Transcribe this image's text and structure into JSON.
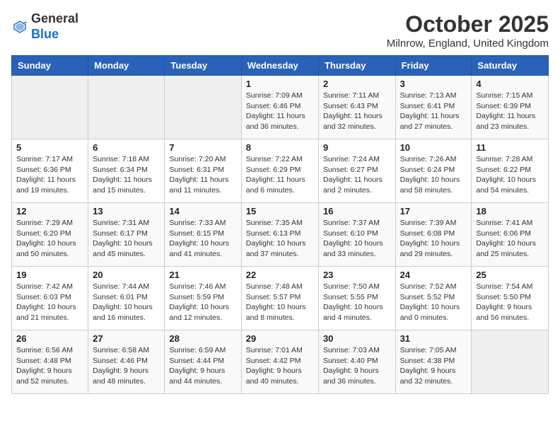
{
  "logo": {
    "general": "General",
    "blue": "Blue"
  },
  "title": "October 2025",
  "location": "Milnrow, England, United Kingdom",
  "days_of_week": [
    "Sunday",
    "Monday",
    "Tuesday",
    "Wednesday",
    "Thursday",
    "Friday",
    "Saturday"
  ],
  "weeks": [
    [
      {
        "num": "",
        "info": ""
      },
      {
        "num": "",
        "info": ""
      },
      {
        "num": "",
        "info": ""
      },
      {
        "num": "1",
        "info": "Sunrise: 7:09 AM\nSunset: 6:46 PM\nDaylight: 11 hours and 36 minutes."
      },
      {
        "num": "2",
        "info": "Sunrise: 7:11 AM\nSunset: 6:43 PM\nDaylight: 11 hours and 32 minutes."
      },
      {
        "num": "3",
        "info": "Sunrise: 7:13 AM\nSunset: 6:41 PM\nDaylight: 11 hours and 27 minutes."
      },
      {
        "num": "4",
        "info": "Sunrise: 7:15 AM\nSunset: 6:39 PM\nDaylight: 11 hours and 23 minutes."
      }
    ],
    [
      {
        "num": "5",
        "info": "Sunrise: 7:17 AM\nSunset: 6:36 PM\nDaylight: 11 hours and 19 minutes."
      },
      {
        "num": "6",
        "info": "Sunrise: 7:18 AM\nSunset: 6:34 PM\nDaylight: 11 hours and 15 minutes."
      },
      {
        "num": "7",
        "info": "Sunrise: 7:20 AM\nSunset: 6:31 PM\nDaylight: 11 hours and 11 minutes."
      },
      {
        "num": "8",
        "info": "Sunrise: 7:22 AM\nSunset: 6:29 PM\nDaylight: 11 hours and 6 minutes."
      },
      {
        "num": "9",
        "info": "Sunrise: 7:24 AM\nSunset: 6:27 PM\nDaylight: 11 hours and 2 minutes."
      },
      {
        "num": "10",
        "info": "Sunrise: 7:26 AM\nSunset: 6:24 PM\nDaylight: 10 hours and 58 minutes."
      },
      {
        "num": "11",
        "info": "Sunrise: 7:28 AM\nSunset: 6:22 PM\nDaylight: 10 hours and 54 minutes."
      }
    ],
    [
      {
        "num": "12",
        "info": "Sunrise: 7:29 AM\nSunset: 6:20 PM\nDaylight: 10 hours and 50 minutes."
      },
      {
        "num": "13",
        "info": "Sunrise: 7:31 AM\nSunset: 6:17 PM\nDaylight: 10 hours and 45 minutes."
      },
      {
        "num": "14",
        "info": "Sunrise: 7:33 AM\nSunset: 6:15 PM\nDaylight: 10 hours and 41 minutes."
      },
      {
        "num": "15",
        "info": "Sunrise: 7:35 AM\nSunset: 6:13 PM\nDaylight: 10 hours and 37 minutes."
      },
      {
        "num": "16",
        "info": "Sunrise: 7:37 AM\nSunset: 6:10 PM\nDaylight: 10 hours and 33 minutes."
      },
      {
        "num": "17",
        "info": "Sunrise: 7:39 AM\nSunset: 6:08 PM\nDaylight: 10 hours and 29 minutes."
      },
      {
        "num": "18",
        "info": "Sunrise: 7:41 AM\nSunset: 6:06 PM\nDaylight: 10 hours and 25 minutes."
      }
    ],
    [
      {
        "num": "19",
        "info": "Sunrise: 7:42 AM\nSunset: 6:03 PM\nDaylight: 10 hours and 21 minutes."
      },
      {
        "num": "20",
        "info": "Sunrise: 7:44 AM\nSunset: 6:01 PM\nDaylight: 10 hours and 16 minutes."
      },
      {
        "num": "21",
        "info": "Sunrise: 7:46 AM\nSunset: 5:59 PM\nDaylight: 10 hours and 12 minutes."
      },
      {
        "num": "22",
        "info": "Sunrise: 7:48 AM\nSunset: 5:57 PM\nDaylight: 10 hours and 8 minutes."
      },
      {
        "num": "23",
        "info": "Sunrise: 7:50 AM\nSunset: 5:55 PM\nDaylight: 10 hours and 4 minutes."
      },
      {
        "num": "24",
        "info": "Sunrise: 7:52 AM\nSunset: 5:52 PM\nDaylight: 10 hours and 0 minutes."
      },
      {
        "num": "25",
        "info": "Sunrise: 7:54 AM\nSunset: 5:50 PM\nDaylight: 9 hours and 56 minutes."
      }
    ],
    [
      {
        "num": "26",
        "info": "Sunrise: 6:56 AM\nSunset: 4:48 PM\nDaylight: 9 hours and 52 minutes."
      },
      {
        "num": "27",
        "info": "Sunrise: 6:58 AM\nSunset: 4:46 PM\nDaylight: 9 hours and 48 minutes."
      },
      {
        "num": "28",
        "info": "Sunrise: 6:59 AM\nSunset: 4:44 PM\nDaylight: 9 hours and 44 minutes."
      },
      {
        "num": "29",
        "info": "Sunrise: 7:01 AM\nSunset: 4:42 PM\nDaylight: 9 hours and 40 minutes."
      },
      {
        "num": "30",
        "info": "Sunrise: 7:03 AM\nSunset: 4:40 PM\nDaylight: 9 hours and 36 minutes."
      },
      {
        "num": "31",
        "info": "Sunrise: 7:05 AM\nSunset: 4:38 PM\nDaylight: 9 hours and 32 minutes."
      },
      {
        "num": "",
        "info": ""
      }
    ]
  ]
}
